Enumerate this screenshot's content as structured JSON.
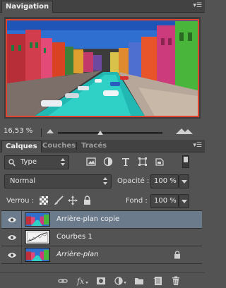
{
  "navigator": {
    "tab_label": "Navigation",
    "zoom_value": "16,53 %"
  },
  "layers_panel": {
    "tabs": [
      {
        "label": "Calques"
      },
      {
        "label": "Couches"
      },
      {
        "label": "Tracés"
      }
    ],
    "filter_kind": "Type",
    "blend_mode": "Normal",
    "opacity_label": "Opacité :",
    "opacity_value": "100 %",
    "lock_label": "Verrou :",
    "fill_label": "Fond :",
    "fill_value": "100 %",
    "layers": [
      {
        "name": "Arrière-plan copie"
      },
      {
        "name": "Courbes 1"
      },
      {
        "name": "Arrière-plan"
      }
    ]
  },
  "colors": {
    "panel_bg": "#535353",
    "selected_layer": "#6b7b8c",
    "view_frame": "#e0432e"
  }
}
